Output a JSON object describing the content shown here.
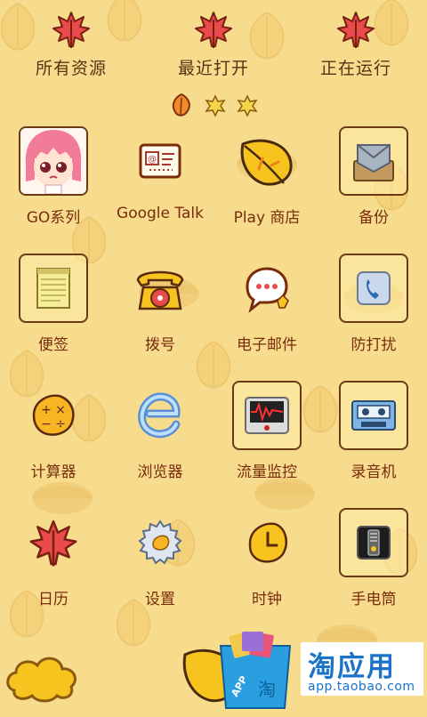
{
  "tabs": [
    {
      "label": "所有资源",
      "icon": "maple-leaf-icon"
    },
    {
      "label": "最近打开",
      "icon": "maple-leaf-icon"
    },
    {
      "label": "正在运行",
      "icon": "maple-leaf-icon"
    }
  ],
  "page_indicator": {
    "pages": 3,
    "current": 1
  },
  "apps": [
    {
      "label": "GO系列",
      "icon": "anime-girl-icon",
      "boxed": true
    },
    {
      "label": "Google Talk",
      "icon": "talk-card-icon",
      "boxed": false
    },
    {
      "label": "Play 商店",
      "icon": "yellow-leaf-icon",
      "boxed": false
    },
    {
      "label": "备份",
      "icon": "envelope-icon",
      "boxed": true
    },
    {
      "label": "便签",
      "icon": "notepad-icon",
      "boxed": true
    },
    {
      "label": "拨号",
      "icon": "rotary-phone-icon",
      "boxed": false
    },
    {
      "label": "电子邮件",
      "icon": "chat-bubble-icon",
      "boxed": false
    },
    {
      "label": "防打扰",
      "icon": "blocked-phone-icon",
      "boxed": true
    },
    {
      "label": "计算器",
      "icon": "calculator-leaf-icon",
      "boxed": false
    },
    {
      "label": "浏览器",
      "icon": "browser-e-icon",
      "boxed": false
    },
    {
      "label": "流量监控",
      "icon": "traffic-monitor-icon",
      "boxed": true
    },
    {
      "label": "录音机",
      "icon": "cassette-icon",
      "boxed": true
    },
    {
      "label": "日历",
      "icon": "red-leaf-icon",
      "boxed": false
    },
    {
      "label": "设置",
      "icon": "gear-leaf-icon",
      "boxed": false
    },
    {
      "label": "时钟",
      "icon": "clock-leaf-icon",
      "boxed": false
    },
    {
      "label": "手电筒",
      "icon": "flashlight-icon",
      "boxed": true
    }
  ],
  "banner": {
    "brand_name": "淘应用",
    "url": "app.taobao.com",
    "bag_label": "APP",
    "bag_char": "淘"
  },
  "colors": {
    "background": "#f7dc8e",
    "label_text": "#7a2b0b",
    "tab_text": "#5b3212",
    "accent_red": "#e94b4b",
    "accent_yellow": "#f5c22c",
    "brand_blue": "#1a73c8"
  }
}
